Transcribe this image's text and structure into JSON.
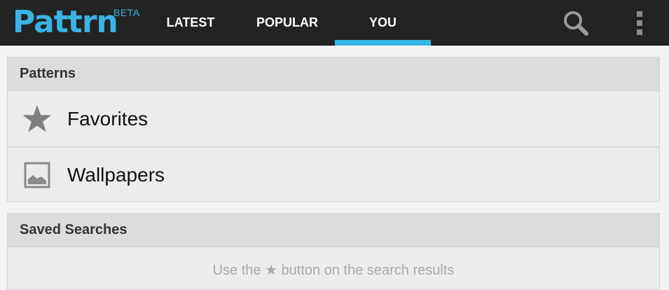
{
  "app": {
    "logo": "Pattrn",
    "badge": "BETA"
  },
  "tabs": [
    {
      "label": "LATEST",
      "active": false
    },
    {
      "label": "POPULAR",
      "active": false
    },
    {
      "label": "YOU",
      "active": true
    }
  ],
  "toolbar": {
    "search_icon": "search-icon",
    "overflow_icon": "overflow-menu-icon"
  },
  "patterns": {
    "header": "Patterns",
    "items": [
      {
        "label": "Favorites",
        "icon": "star-icon"
      },
      {
        "label": "Wallpapers",
        "icon": "image-icon"
      }
    ]
  },
  "saved_searches": {
    "header": "Saved Searches",
    "hint": "Use the ★ button on the search results"
  },
  "colors": {
    "accent": "#33b5e5",
    "actionbar": "#232323",
    "card_header": "#dcdcdc",
    "card_body": "#ececec"
  }
}
